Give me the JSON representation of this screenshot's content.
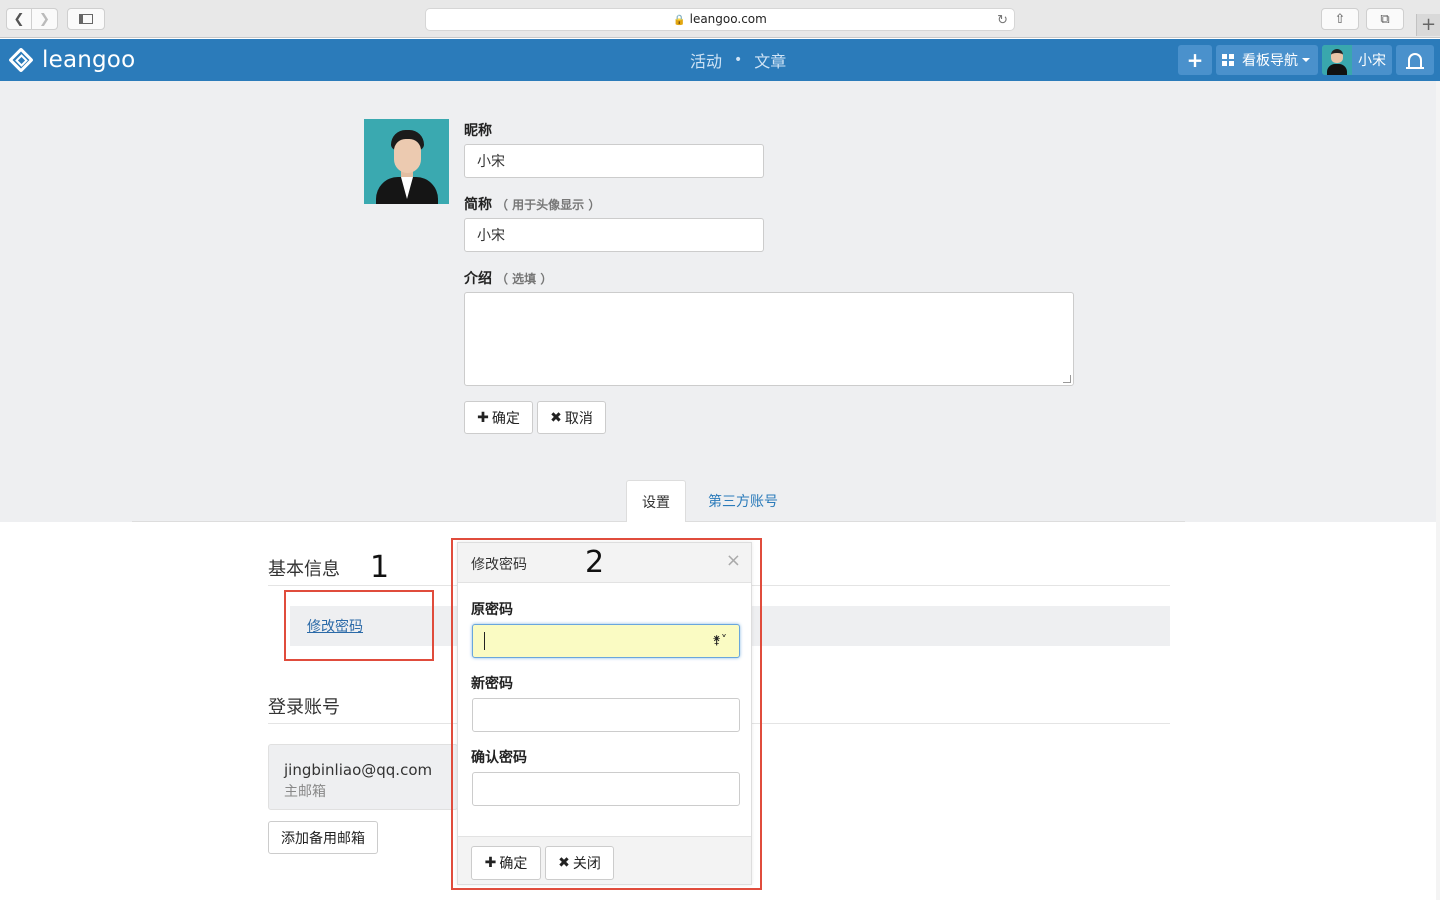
{
  "browser": {
    "url": "leangoo.com"
  },
  "nav": {
    "brand": "leangoo",
    "center_links": [
      "活动",
      "文章"
    ],
    "center_sep": "•",
    "add_label": "+",
    "boards_label": "看板导航",
    "user_name": "小宋"
  },
  "profile": {
    "nickname_label": "昵称",
    "nickname_value": "小宋",
    "short_label": "简称",
    "short_hint": "（ 用于头像显示 ）",
    "short_value": "小宋",
    "intro_label": "介绍",
    "intro_hint": "（ 选填 ）",
    "intro_value": "",
    "confirm_label": "确定",
    "cancel_label": "取消"
  },
  "tabs": {
    "active": "设置",
    "other": "第三方账号"
  },
  "settings": {
    "basic_title": "基本信息",
    "change_pwd_link": "修改密码",
    "login_title": "登录账号",
    "email": "jingbinliao@qq.com",
    "email_tag": "主邮箱",
    "add_backup_label": "添加备用邮箱"
  },
  "annotations": {
    "one": "1",
    "two": "2"
  },
  "modal": {
    "title": "修改密码",
    "close": "×",
    "old_label": "原密码",
    "new_label": "新密码",
    "confirm_pwd_label": "确认密码",
    "ok_label": "确定",
    "close_label": "关闭"
  },
  "icons": {
    "plus": "✚",
    "times": "✖"
  },
  "colors": {
    "brand": "#2b7bba",
    "highlight": "#e04c3c",
    "autofill": "#fafbc3"
  }
}
